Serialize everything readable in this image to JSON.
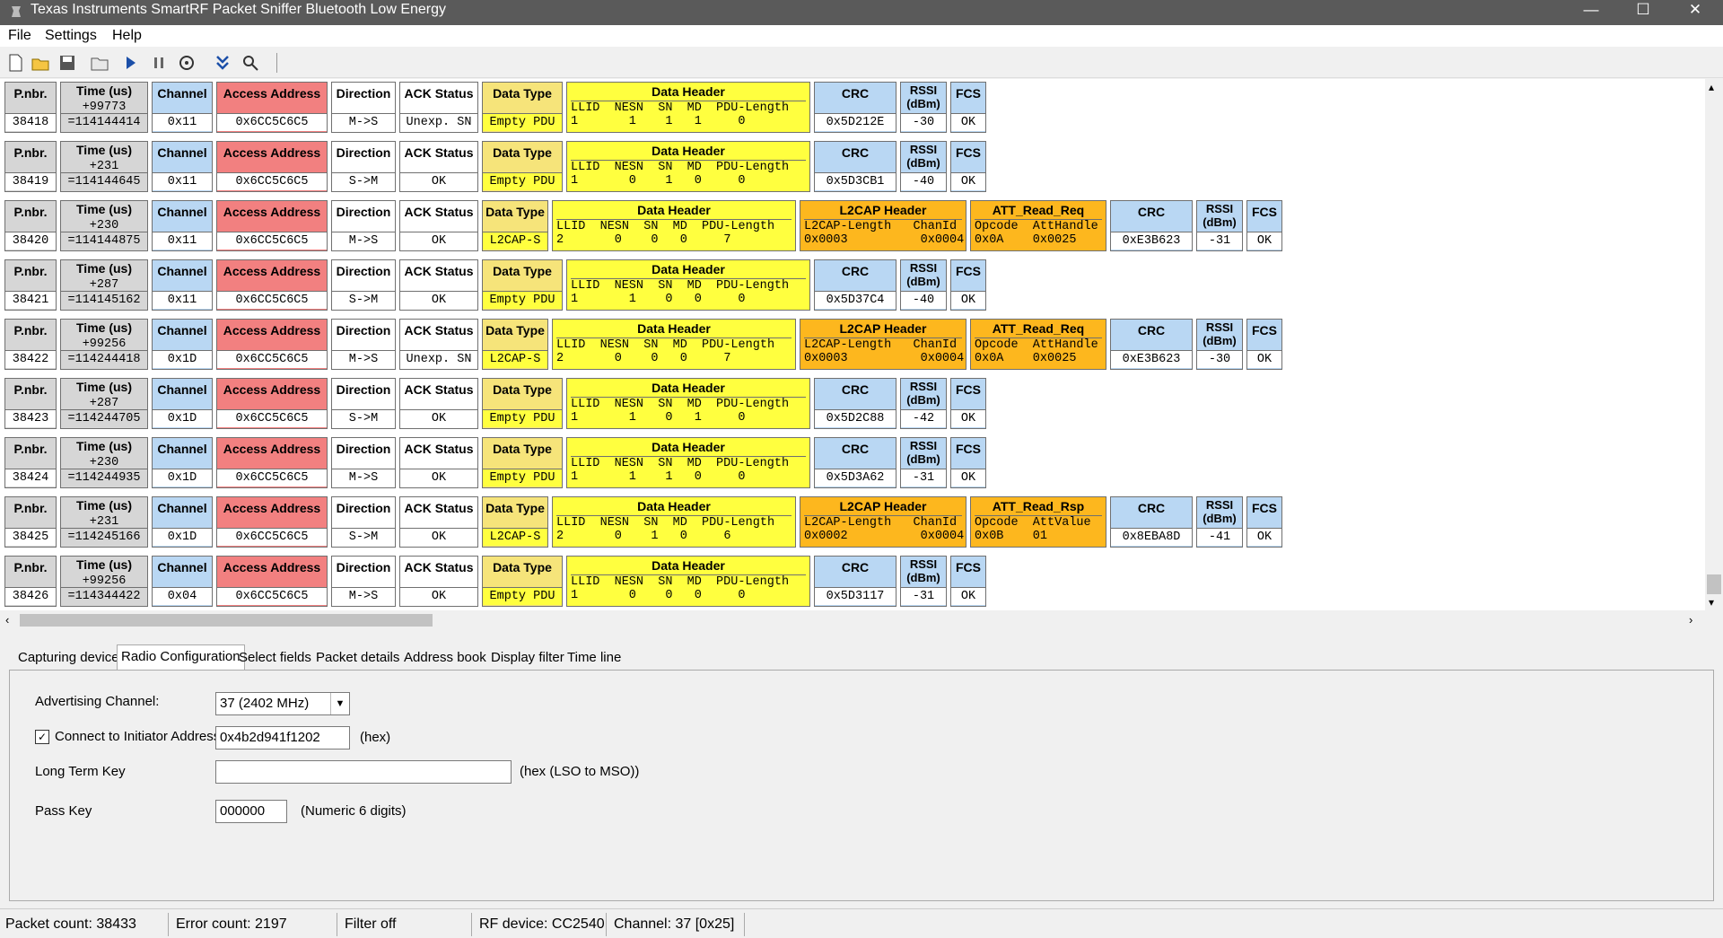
{
  "window": {
    "title": "Texas Instruments SmartRF Packet Sniffer Bluetooth Low Energy"
  },
  "menu": [
    "File",
    "Settings",
    "Help"
  ],
  "toolbar": {
    "icons": [
      "new-icon",
      "open-icon",
      "save-icon",
      "folder-icon",
      "play-icon",
      "pause-icon",
      "config-icon",
      "scroll-down-icon",
      "filter-icon"
    ]
  },
  "field_labels": {
    "pnbr": "P.nbr.",
    "time": "Time (us)",
    "channel": "Channel",
    "access": "Access Address",
    "direction": "Direction",
    "ack": "ACK Status",
    "dtype": "Data Type",
    "dheader": "Data Header",
    "dheader_cols": "LLID  NESN  SN  MD  PDU-Length",
    "dheader_cols_short": "LLID  NESN  SN  MD  PDU-Length",
    "l2cap": "L2CAP Header",
    "l2cap_cols": "L2CAP-Length   ChanId",
    "crc": "CRC",
    "rssi": "RSSI (dBm)",
    "fcs": "FCS",
    "att_req_cols": "Opcode  AttHandle",
    "att_rsp_cols": "Opcode  AttValue"
  },
  "packets": [
    {
      "pnbr": "38418",
      "time_delta": "+99773",
      "time_abs": "=114144414",
      "channel": "0x11",
      "access": "0x6CC5C6C5",
      "direction": "M->S",
      "ack": "Unexp. SN",
      "dtype": "Empty PDU",
      "dheader_vals": "1       1    1   1     0",
      "crc": "0x5D212E",
      "rssi": "-30",
      "fcs": "OK"
    },
    {
      "pnbr": "38419",
      "time_delta": "+231",
      "time_abs": "=114144645",
      "channel": "0x11",
      "access": "0x6CC5C6C5",
      "direction": "S->M",
      "ack": "OK",
      "dtype": "Empty PDU",
      "dheader_vals": "1       0    1   0     0",
      "crc": "0x5D3CB1",
      "rssi": "-40",
      "fcs": "OK"
    },
    {
      "pnbr": "38420",
      "time_delta": "+230",
      "time_abs": "=114144875",
      "channel": "0x11",
      "access": "0x6CC5C6C5",
      "direction": "M->S",
      "ack": "OK",
      "dtype": "L2CAP-S",
      "dheader_vals": "2       0    0   0     7",
      "l2cap_vals": "0x0003          0x0004",
      "att_name": "ATT_Read_Req",
      "att_vals": "0x0A    0x0025",
      "crc": "0xE3B623",
      "rssi": "-31",
      "fcs": "OK"
    },
    {
      "pnbr": "38421",
      "time_delta": "+287",
      "time_abs": "=114145162",
      "channel": "0x11",
      "access": "0x6CC5C6C5",
      "direction": "S->M",
      "ack": "OK",
      "dtype": "Empty PDU",
      "dheader_vals": "1       1    0   0     0",
      "crc": "0x5D37C4",
      "rssi": "-40",
      "fcs": "OK"
    },
    {
      "pnbr": "38422",
      "time_delta": "+99256",
      "time_abs": "=114244418",
      "channel": "0x1D",
      "access": "0x6CC5C6C5",
      "direction": "M->S",
      "ack": "Unexp. SN",
      "dtype": "L2CAP-S",
      "dheader_vals": "2       0    0   0     7",
      "l2cap_vals": "0x0003          0x0004",
      "att_name": "ATT_Read_Req",
      "att_vals": "0x0A    0x0025",
      "crc": "0xE3B623",
      "rssi": "-30",
      "fcs": "OK"
    },
    {
      "pnbr": "38423",
      "time_delta": "+287",
      "time_abs": "=114244705",
      "channel": "0x1D",
      "access": "0x6CC5C6C5",
      "direction": "S->M",
      "ack": "OK",
      "dtype": "Empty PDU",
      "dheader_vals": "1       1    0   1     0",
      "crc": "0x5D2C88",
      "rssi": "-42",
      "fcs": "OK"
    },
    {
      "pnbr": "38424",
      "time_delta": "+230",
      "time_abs": "=114244935",
      "channel": "0x1D",
      "access": "0x6CC5C6C5",
      "direction": "M->S",
      "ack": "OK",
      "dtype": "Empty PDU",
      "dheader_vals": "1       1    1   0     0",
      "crc": "0x5D3A62",
      "rssi": "-31",
      "fcs": "OK"
    },
    {
      "pnbr": "38425",
      "time_delta": "+231",
      "time_abs": "=114245166",
      "channel": "0x1D",
      "access": "0x6CC5C6C5",
      "direction": "S->M",
      "ack": "OK",
      "dtype": "L2CAP-S",
      "dheader_vals": "2       0    1   0     6",
      "l2cap_vals": "0x0002          0x0004",
      "att_name": "ATT_Read_Rsp",
      "att_vals": "0x0B    01",
      "crc": "0x8EBA8D",
      "rssi": "-41",
      "fcs": "OK"
    },
    {
      "pnbr": "38426",
      "time_delta": "+99256",
      "time_abs": "=114344422",
      "channel": "0x04",
      "access": "0x6CC5C6C5",
      "direction": "M->S",
      "ack": "OK",
      "dtype": "Empty PDU",
      "dheader_vals": "1       0    0   0     0",
      "crc": "0x5D3117",
      "rssi": "-31",
      "fcs": "OK"
    }
  ],
  "tabs": [
    "Capturing device",
    "Radio Configuration",
    "Select fields",
    "Packet details",
    "Address book",
    "Display filter",
    "Time line"
  ],
  "radio_config": {
    "adv_channel_label": "Advertising Channel:",
    "adv_channel_value": "37 (2402 MHz)",
    "connect_label": "Connect to Initiator Address",
    "connect_checked": true,
    "connect_value": "0x4b2d941f1202",
    "connect_hint": "(hex)",
    "ltk_label": "Long Term Key",
    "ltk_value": "",
    "ltk_hint": "(hex (LSO to MSO))",
    "passkey_label": "Pass Key",
    "passkey_value": "000000",
    "passkey_hint": "(Numeric 6 digits)"
  },
  "status": {
    "packet_count": "Packet count: 38433",
    "error_count": "Error count: 2197",
    "filter": "Filter off",
    "rf_device": "RF device: CC2540",
    "channel": "Channel: 37 [0x25]"
  }
}
